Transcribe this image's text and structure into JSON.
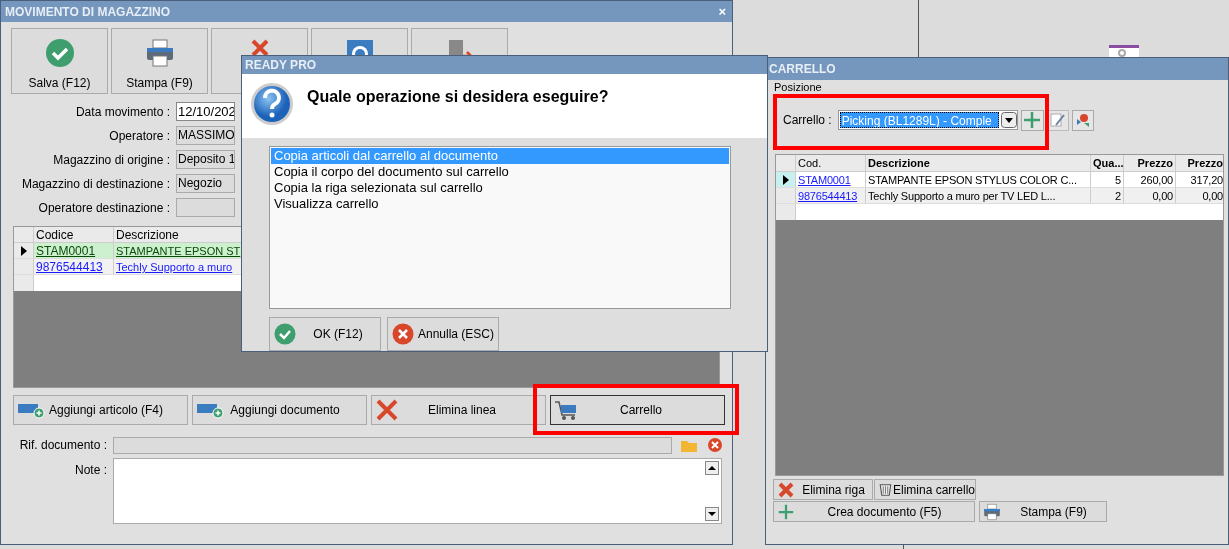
{
  "main_window": {
    "title": "MOVIMENTO DI MAGAZZINO",
    "close": "×",
    "toolbar": [
      {
        "kind": "save",
        "label": "Salva (F12)"
      },
      {
        "kind": "print",
        "label": "Stampa (F9)"
      },
      {
        "kind": "delete"
      },
      {
        "kind": "scan"
      },
      {
        "kind": "exit"
      }
    ],
    "fields": [
      {
        "label": "Data movimento :",
        "value": "12/10/202",
        "editable": true
      },
      {
        "label": "Operatore :",
        "value": "MASSIMO",
        "editable": false
      },
      {
        "label": "Magazzino di origine :",
        "value": "Deposito 1",
        "editable": false
      },
      {
        "label": "Magazzino di destinazione :",
        "value": "Negozio",
        "editable": false
      },
      {
        "label": "Operatore destinazione :",
        "editable": false
      }
    ],
    "table": {
      "columns": [
        "Codice",
        "Descrizione"
      ],
      "rows": [
        {
          "selected": true,
          "cells": [
            "STAM0001",
            "STAMPANTE EPSON ST"
          ]
        },
        {
          "selected": false,
          "cells": [
            "9876544413",
            "Techly Supporto a muro"
          ]
        }
      ]
    },
    "buttons": [
      {
        "kind": "add",
        "label": "Aggiungi articolo (F4)",
        "highlighted": false
      },
      {
        "kind": "add",
        "label": "Aggiungi documento",
        "highlighted": false
      },
      {
        "kind": "delete",
        "label": "Elimina linea",
        "highlighted": false
      },
      {
        "kind": "cart",
        "label": "Carrello",
        "highlighted": true
      }
    ],
    "rif_label": "Rif. documento :",
    "note_label": "Note :"
  },
  "dialog": {
    "title": "READY PRO",
    "question": "Quale operazione si desidera eseguire?",
    "options": [
      {
        "label": "Copia articoli dal carrello al documento",
        "selected": true
      },
      {
        "label": "Copia il corpo del documento sul carrello",
        "selected": false
      },
      {
        "label": "Copia la riga selezionata sul carrello",
        "selected": false
      },
      {
        "label": "Visualizza carrello",
        "selected": false
      }
    ],
    "buttons": [
      {
        "kind": "ok",
        "label": "OK (F12)"
      },
      {
        "kind": "cancel",
        "label": "Annulla (ESC)"
      }
    ]
  },
  "cart_window": {
    "title": "CARRELLO",
    "tab": "Posizione",
    "cart_label": "Carrello :",
    "cart_value": "Picking (BL1289L) - Comple",
    "highlighted": true,
    "table": {
      "columns": [
        "Cod.",
        "Descrizione",
        "Qua...",
        "Prezzo",
        "Prezzo"
      ],
      "rows": [
        {
          "selected": true,
          "cells": [
            "STAM0001",
            "STAMPANTE EPSON STYLUS COLOR C...",
            "5",
            "260,00",
            "317,20"
          ]
        },
        {
          "selected": false,
          "cells": [
            "9876544413",
            "Techly Supporto a muro per TV LED L...",
            "2",
            "0,00",
            "0,00"
          ]
        }
      ]
    },
    "buttons": [
      {
        "kind": "delete",
        "label": "Elimina riga"
      },
      {
        "kind": "trash",
        "label": "Elimina carrello"
      },
      {
        "kind": "add",
        "label": "Crea documento (F5)"
      },
      {
        "kind": "print",
        "label": "Stampa (F9)"
      }
    ]
  }
}
